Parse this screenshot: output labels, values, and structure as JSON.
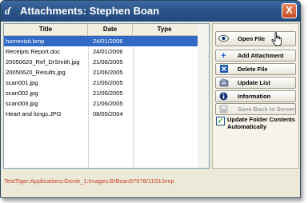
{
  "window": {
    "title": "Attachments: Stephen Boan",
    "app_icon": "genie-logo-icon",
    "close_label": "X"
  },
  "list": {
    "columns": {
      "title": "Title",
      "date": "Date",
      "type": "Type"
    },
    "rows": [
      {
        "title": "homevisit.bmp",
        "date": "24/01/2006",
        "type": "",
        "selected": true
      },
      {
        "title": "Receipts Report.doc",
        "date": "24/01/2006",
        "type": ""
      },
      {
        "title": "20050620_Ref_DrSmith.jpg",
        "date": "21/06/2005",
        "type": ""
      },
      {
        "title": "20050620_Results.jpg",
        "date": "21/06/2005",
        "type": ""
      },
      {
        "title": "scan001.jpg",
        "date": "21/06/2005",
        "type": ""
      },
      {
        "title": "scan002.jpg",
        "date": "21/06/2005",
        "type": ""
      },
      {
        "title": "scan003.jpg",
        "date": "21/06/2005",
        "type": ""
      },
      {
        "title": "Heart and lungs.JPG",
        "date": "08/05/2004",
        "type": ""
      }
    ]
  },
  "actions": {
    "open_file": {
      "label": "Open File",
      "icon": "eye-icon"
    },
    "add_attachment": {
      "label": "Add Attachment",
      "icon": "plus-icon"
    },
    "delete_file": {
      "label": "Delete File",
      "icon": "delete-x-icon"
    },
    "update_list": {
      "label": "Update List",
      "icon": "folder-update-icon"
    },
    "information": {
      "label": "Information",
      "icon": "info-icon"
    },
    "save_back": {
      "label": "Save Back to Server",
      "icon": "save-server-icon",
      "enabled": false
    }
  },
  "options": {
    "update_folder_label": "Update Folder Contents Automatically",
    "update_folder_checked": true
  },
  "status": {
    "path": "TestTiger:Applications:Genie_1:Images:B/Boan57978/1103.bmp"
  },
  "colors": {
    "titlebar": "#2b5488",
    "selection": "#316ac5",
    "status_text": "#c8402c",
    "window_bg": "#ece9d8"
  }
}
